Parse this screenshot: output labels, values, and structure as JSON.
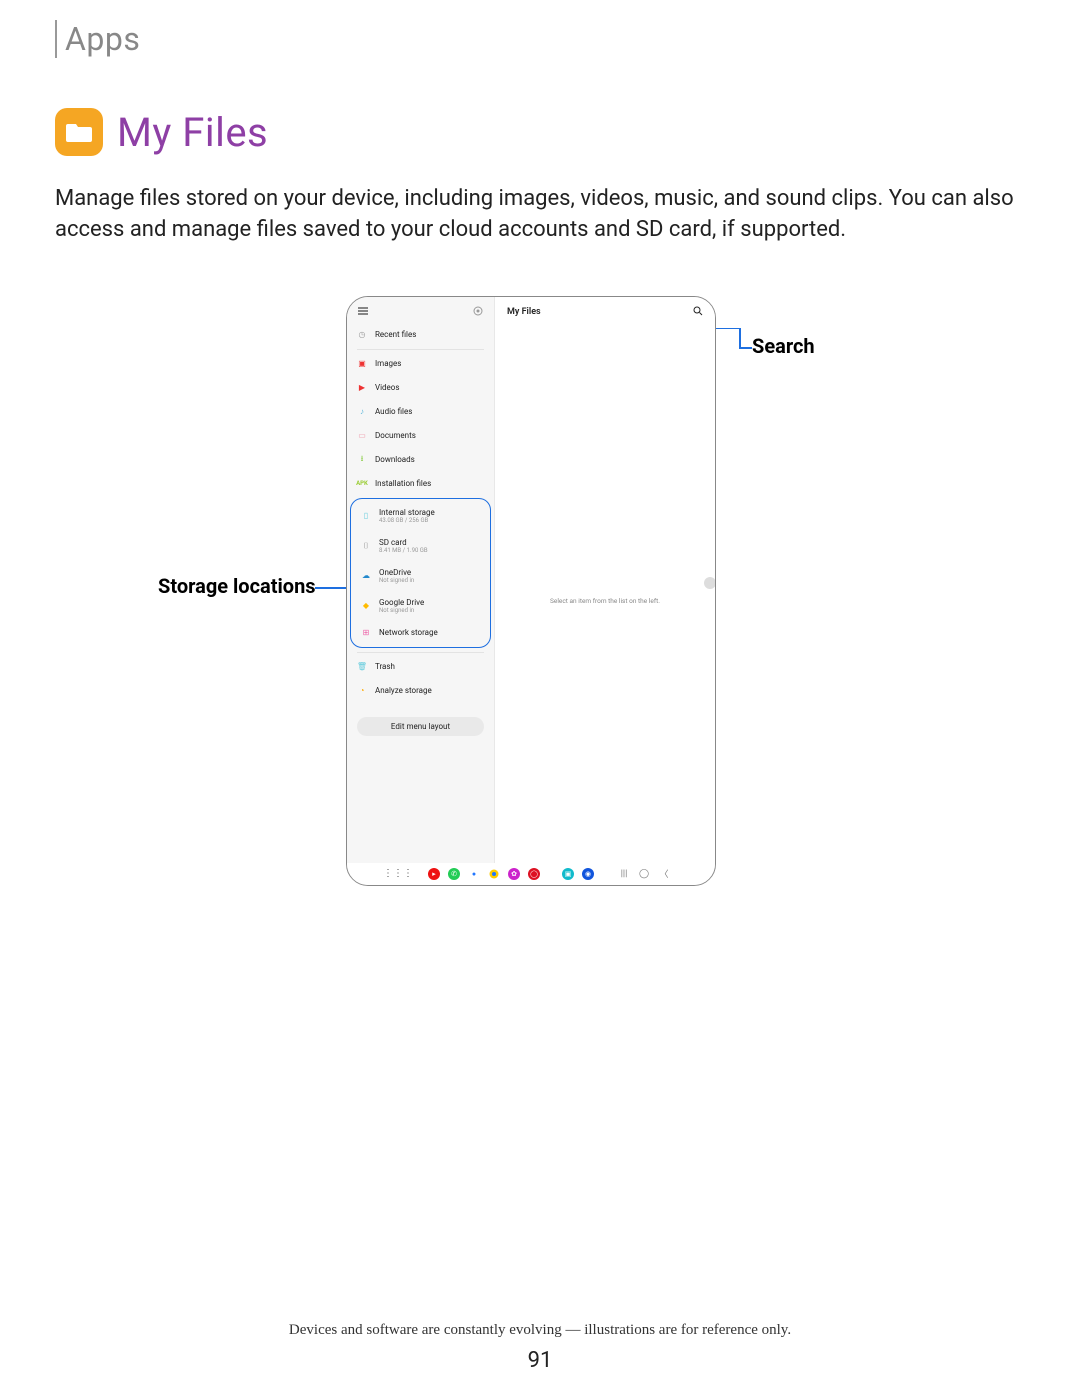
{
  "header": {
    "section": "Apps"
  },
  "title": {
    "text": "My Files"
  },
  "body": "Manage files stored on your device, including images, videos, music, and sound clips. You can also access and manage files saved to your cloud accounts and SD card, if supported.",
  "callouts": {
    "search": "Search",
    "storage": "Storage locations"
  },
  "device": {
    "main_title": "My Files",
    "empty_hint": "Select an item from the list on the left.",
    "menu": {
      "recent": "Recent files",
      "images": "Images",
      "videos": "Videos",
      "audio": "Audio files",
      "documents": "Documents",
      "downloads": "Downloads",
      "installation": "Installation files"
    },
    "storage": {
      "internal": {
        "label": "Internal storage",
        "sub": "43.08 GB / 256 GB"
      },
      "sdcard": {
        "label": "SD card",
        "sub": "8.41 MB / 1.90 GB"
      },
      "onedrive": {
        "label": "OneDrive",
        "sub": "Not signed in"
      },
      "gdrive": {
        "label": "Google Drive",
        "sub": "Not signed in"
      },
      "network": {
        "label": "Network storage"
      }
    },
    "trash": "Trash",
    "analyze": "Analyze storage",
    "edit_layout": "Edit menu layout"
  },
  "footnote": "Devices and software are constantly evolving — illustrations are for reference only.",
  "page_number": "91"
}
